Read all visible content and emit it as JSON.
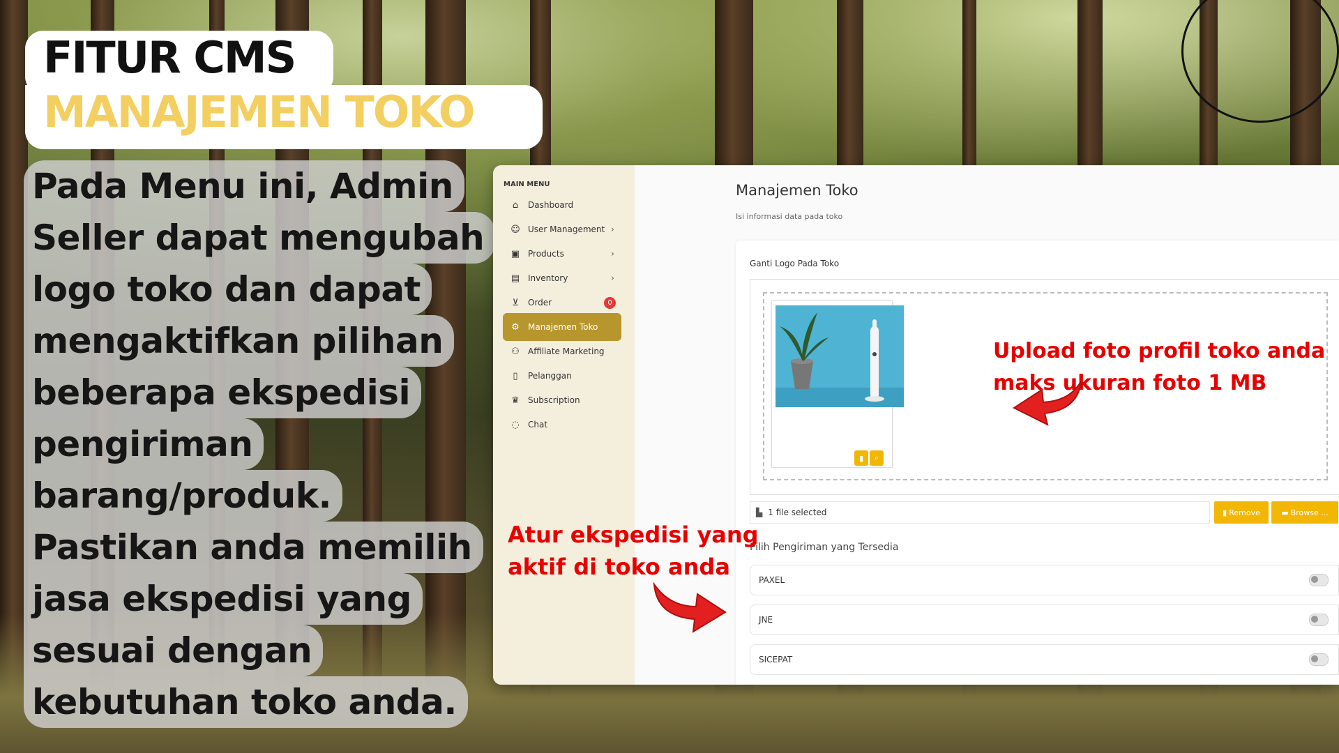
{
  "heading": {
    "line1": "FITUR CMS",
    "line2": "MANAJEMEN TOKO"
  },
  "description_lines": [
    "Pada Menu ini, Admin",
    "Seller dapat mengubah",
    "logo toko dan dapat",
    "mengaktifkan pilihan",
    "beberapa ekspedisi",
    "pengiriman",
    "barang/produk.",
    "Pastikan anda memilih",
    "jasa ekspedisi yang",
    "sesuai dengan",
    "kebutuhan toko anda."
  ],
  "colors": {
    "accent_yellow": "#f3cf61",
    "active_menu": "#b8962e",
    "annotation_red": "#e60000",
    "button_yellow": "#f2b705"
  },
  "sidebar": {
    "header": "MAIN MENU",
    "items": [
      {
        "label": "Dashboard",
        "icon": "home-icon"
      },
      {
        "label": "User Management",
        "icon": "user-icon",
        "chevron": true
      },
      {
        "label": "Products",
        "icon": "box-icon",
        "chevron": true
      },
      {
        "label": "Inventory",
        "icon": "archive-icon",
        "chevron": true
      },
      {
        "label": "Order",
        "icon": "cart-icon",
        "badge": "0"
      },
      {
        "label": "Manajemen Toko",
        "icon": "settings-icon",
        "active": true
      },
      {
        "label": "Affiliate Marketing",
        "icon": "users-icon"
      },
      {
        "label": "Pelanggan",
        "icon": "contact-icon"
      },
      {
        "label": "Subscription",
        "icon": "crown-icon"
      },
      {
        "label": "Chat",
        "icon": "chat-icon"
      }
    ]
  },
  "main": {
    "title": "Manajemen Toko",
    "subtitle": "Isi informasi data pada toko",
    "logo_section_label": "Ganti Logo Pada Toko",
    "file_selected": "1 file selected",
    "remove_label": "Remove",
    "browse_label": "Browse ...",
    "shipping_label": "Pilih Pengiriman yang Tersedia",
    "couriers": [
      "PAXEL",
      "JNE",
      "SICEPAT"
    ]
  },
  "annotations": {
    "upload_note_1": "Upload foto profil toko anda",
    "upload_note_2": "maks ukuran foto 1 MB",
    "courier_note_1": "Atur ekspedisi yang",
    "courier_note_2": "aktif di toko anda"
  }
}
